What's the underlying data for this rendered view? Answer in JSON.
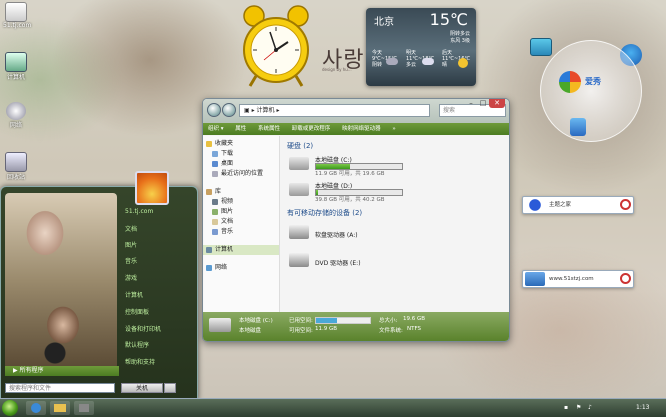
{
  "desktop": {
    "icons": [
      {
        "label": "51.tj.com"
      },
      {
        "label": "计算机"
      },
      {
        "label": "网络"
      },
      {
        "label": "回收站"
      }
    ],
    "wallpaper_text": "사랑",
    "wallpaper_sub": "design by hu..."
  },
  "weather": {
    "city": "北京",
    "temp": "15℃",
    "lines": [
      "阴转多云",
      "东风 3级"
    ],
    "days": [
      {
        "name": "今天",
        "range": "9℃~15℃",
        "desc": "阴转"
      },
      {
        "name": "明天",
        "range": "11℃~18℃",
        "desc": "多云"
      },
      {
        "name": "后天",
        "range": "11℃~16℃",
        "desc": "晴"
      }
    ]
  },
  "window": {
    "address": "计算机",
    "search_placeholder": "搜索",
    "toolbar": [
      "组织 ▾",
      "属性",
      "系统属性",
      "卸载或更改程序",
      "映射网络驱动器",
      "»"
    ],
    "nav": {
      "favorites": "收藏夹",
      "items": [
        "下载",
        "桌面",
        "最近访问的位置"
      ],
      "libraries": "库",
      "lib_items": [
        "视频",
        "图片",
        "文档",
        "音乐"
      ],
      "computer": "计算机",
      "network": "网络"
    },
    "hard_disk_header": "硬盘 (2)",
    "drives": [
      {
        "name": "本地磁盘 (C:)",
        "space": "11.9 GB 可用，共 19.6 GB",
        "used_pct": 39
      },
      {
        "name": "本地磁盘 (D:)",
        "space": "39.8 GB 可用，共 40.2 GB",
        "used_pct": 2
      }
    ],
    "removable_header": "有可移动存储的设备 (2)",
    "devices": [
      {
        "name": "软盘驱动器 (A:)"
      },
      {
        "name": "DVD 驱动器 (E:)"
      }
    ],
    "details": {
      "drive_name": "本地磁盘 (C:)",
      "drive_type": "本地磁盘",
      "used_label": "已用空间:",
      "free_label": "可用空间:",
      "free": "11.9 GB",
      "total_label": "总大小:",
      "total": "19.6 GB",
      "fs_label": "文件系统:",
      "fs": "NTFS"
    }
  },
  "start_menu": {
    "items": [
      "51.tj.com",
      "文档",
      "图片",
      "音乐",
      "游戏",
      "计算机",
      "控制面板",
      "设备和打印机",
      "默认程序",
      "帮助和支持"
    ],
    "all_programs": "所有程序",
    "search_placeholder": "搜索程序和文件",
    "shutdown": "关机"
  },
  "widgets": {
    "brand": "爱秀",
    "search1": "主题之家",
    "search2": "www.51stzj.com"
  },
  "taskbar": {
    "time": "1:13"
  }
}
